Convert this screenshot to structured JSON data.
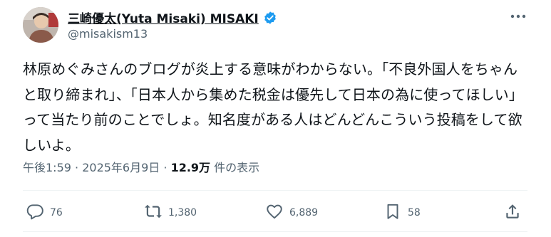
{
  "author": {
    "display_name": "三崎優太(Yuta Misaki) MISAKI",
    "handle": "@misakism13",
    "avatar_icon": "avatar",
    "verified_icon": "verified-badge-icon",
    "verified_color": "#1d9bf0"
  },
  "tweet": {
    "text": "林原めぐみさんのブログが炎上する意味がわからない。「不良外国人をちゃんと取り締まれ」、「日本人から集めた税金は優先して日本の為に使ってほしい」って当たり前のことでしょ。知名度がある人はどんどんこういう投稿をして欲しいよ。"
  },
  "meta": {
    "time": "午後1:59",
    "separator1": " · ",
    "date": "2025年6月9日",
    "separator2": " · ",
    "views": "12.9万",
    "views_suffix": " 件の表示"
  },
  "actions": {
    "replies": "76",
    "reposts": "1,380",
    "likes": "6,889",
    "bookmarks": "58"
  },
  "colors": {
    "text": "#0f1419",
    "secondary": "#536471",
    "divider": "#eff3f4"
  }
}
